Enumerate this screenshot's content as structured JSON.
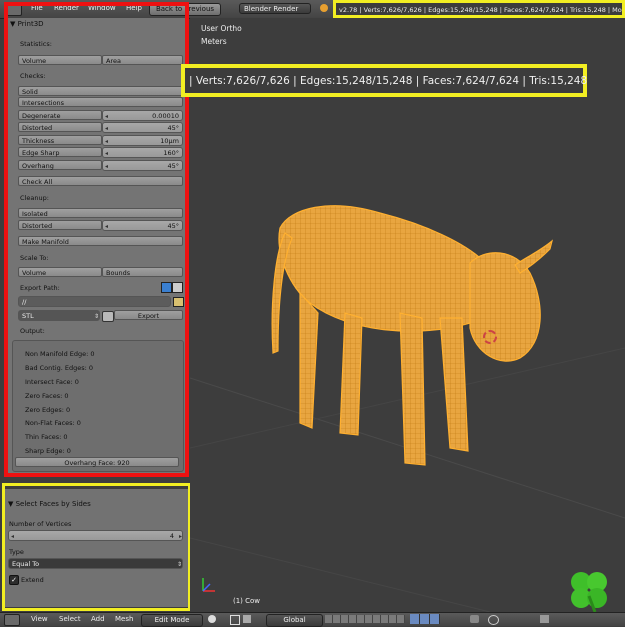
{
  "topbar": {
    "menus": [
      "File",
      "Render",
      "Window",
      "Help"
    ],
    "back_button": "Back to Previous",
    "engine": "Blender Render",
    "stats": "v2.78 | Verts:7,626/7,626 | Edges:15,248/15,248 | Faces:7,624/7,624 | Tris:15,248 | Mo"
  },
  "panel": {
    "title": "Print3D",
    "statistics_label": "Statistics:",
    "volume_btn": "Volume",
    "area_btn": "Area",
    "checks_label": "Checks:",
    "solid_btn": "Solid",
    "intersections_btn": "Intersections",
    "degenerate": {
      "label": "Degenerate",
      "value": "0.00010"
    },
    "distorted": {
      "label": "Distorted",
      "value": "45°"
    },
    "thickness": {
      "label": "Thickness",
      "value": "10μm"
    },
    "edge_sharp": {
      "label": "Edge Sharp",
      "value": "160°"
    },
    "overhang": {
      "label": "Overhang",
      "value": "45°"
    },
    "check_all_btn": "Check All",
    "cleanup_label": "Cleanup:",
    "isolated_btn": "Isolated",
    "distorted2": {
      "label": "Distorted",
      "value": "45°"
    },
    "make_manifold_btn": "Make Manifold",
    "scale_to_label": "Scale To:",
    "scale_volume_btn": "Volume",
    "bounds_btn": "Bounds",
    "export_path_label": "Export Path:",
    "export_path_value": "//",
    "format_value": "STL",
    "export_btn": "Export",
    "output_label": "Output:",
    "output_lines": [
      "Non Manifold Edge: 0",
      "Bad Contig. Edges: 0",
      "Intersect Face: 0",
      "Zero Faces: 0",
      "Zero Edges: 0",
      "Non-Flat Faces: 0",
      "Thin Faces: 0",
      "Sharp Edge: 0"
    ],
    "overhang_result": "Overhang Face: 920"
  },
  "operator": {
    "title": "Select Faces by Sides",
    "num_vertices_label": "Number of Vertices",
    "num_vertices_value": "4",
    "type_label": "Type",
    "type_value": "Equal To",
    "extend_label": "Extend",
    "extend_checked": true
  },
  "viewport": {
    "view_name": "User Ortho",
    "units": "Meters",
    "stats_overlay": "| Verts:7,626/7,626 | Edges:15,248/15,248 | Faces:7,624/7,624 | Tris:15,248",
    "object_label": "(1) Cow"
  },
  "bottombar": {
    "menus": [
      "View",
      "Select",
      "Add",
      "Mesh"
    ],
    "mode": "Edit Mode",
    "orientation": "Global"
  },
  "colors": {
    "highlight_red": "#ee1111",
    "highlight_yellow": "#f2ee22",
    "mesh_orange": "#f0a030",
    "clover_green": "#3fbf2a"
  }
}
